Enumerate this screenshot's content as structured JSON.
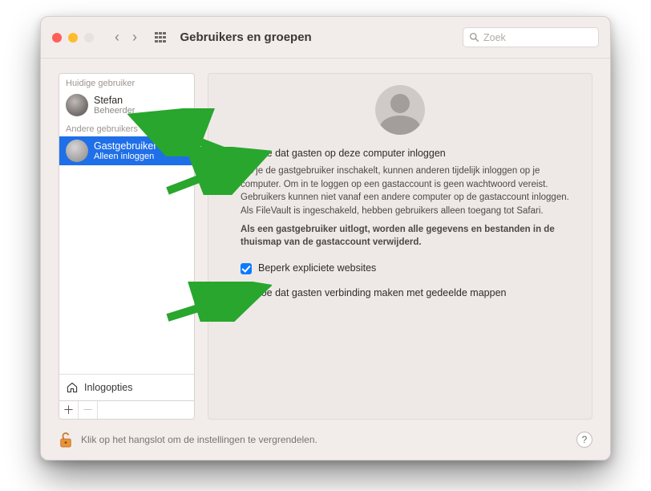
{
  "window": {
    "title": "Gebruikers en groepen",
    "search_placeholder": "Zoek"
  },
  "sidebar": {
    "sections": {
      "current_label": "Huidige gebruiker",
      "other_label": "Andere gebruikers"
    },
    "current_user": {
      "name": "Stefan",
      "role": "Beheerder"
    },
    "guest_user": {
      "name": "Gastgebruiker",
      "role": "Alleen inloggen"
    },
    "login_options_label": "Inlogopties"
  },
  "options": {
    "allow_login": {
      "checked": true,
      "label": "Sta toe dat gasten op deze computer inloggen",
      "desc": "Als je de gastgebruiker inschakelt, kunnen anderen tijdelijk inloggen op je computer. Om in te loggen op een gastaccount is geen wachtwoord vereist. Gebruikers kunnen niet vanaf een andere computer op de gastaccount inloggen. Als FileVault is ingeschakeld, hebben gebruikers alleen toegang tot Safari.",
      "desc_bold": "Als een gastgebruiker uitlogt, worden alle gegevens en bestanden in de thuismap van de gastaccount verwijderd."
    },
    "restrict_sites": {
      "checked": true,
      "label": "Beperk expliciete websites"
    },
    "shared_folders": {
      "checked": false,
      "label": "Sta toe dat gasten verbinding maken met gedeelde mappen"
    }
  },
  "footer": {
    "lock_text": "Klik op het hangslot om de instellingen te vergrendelen."
  }
}
